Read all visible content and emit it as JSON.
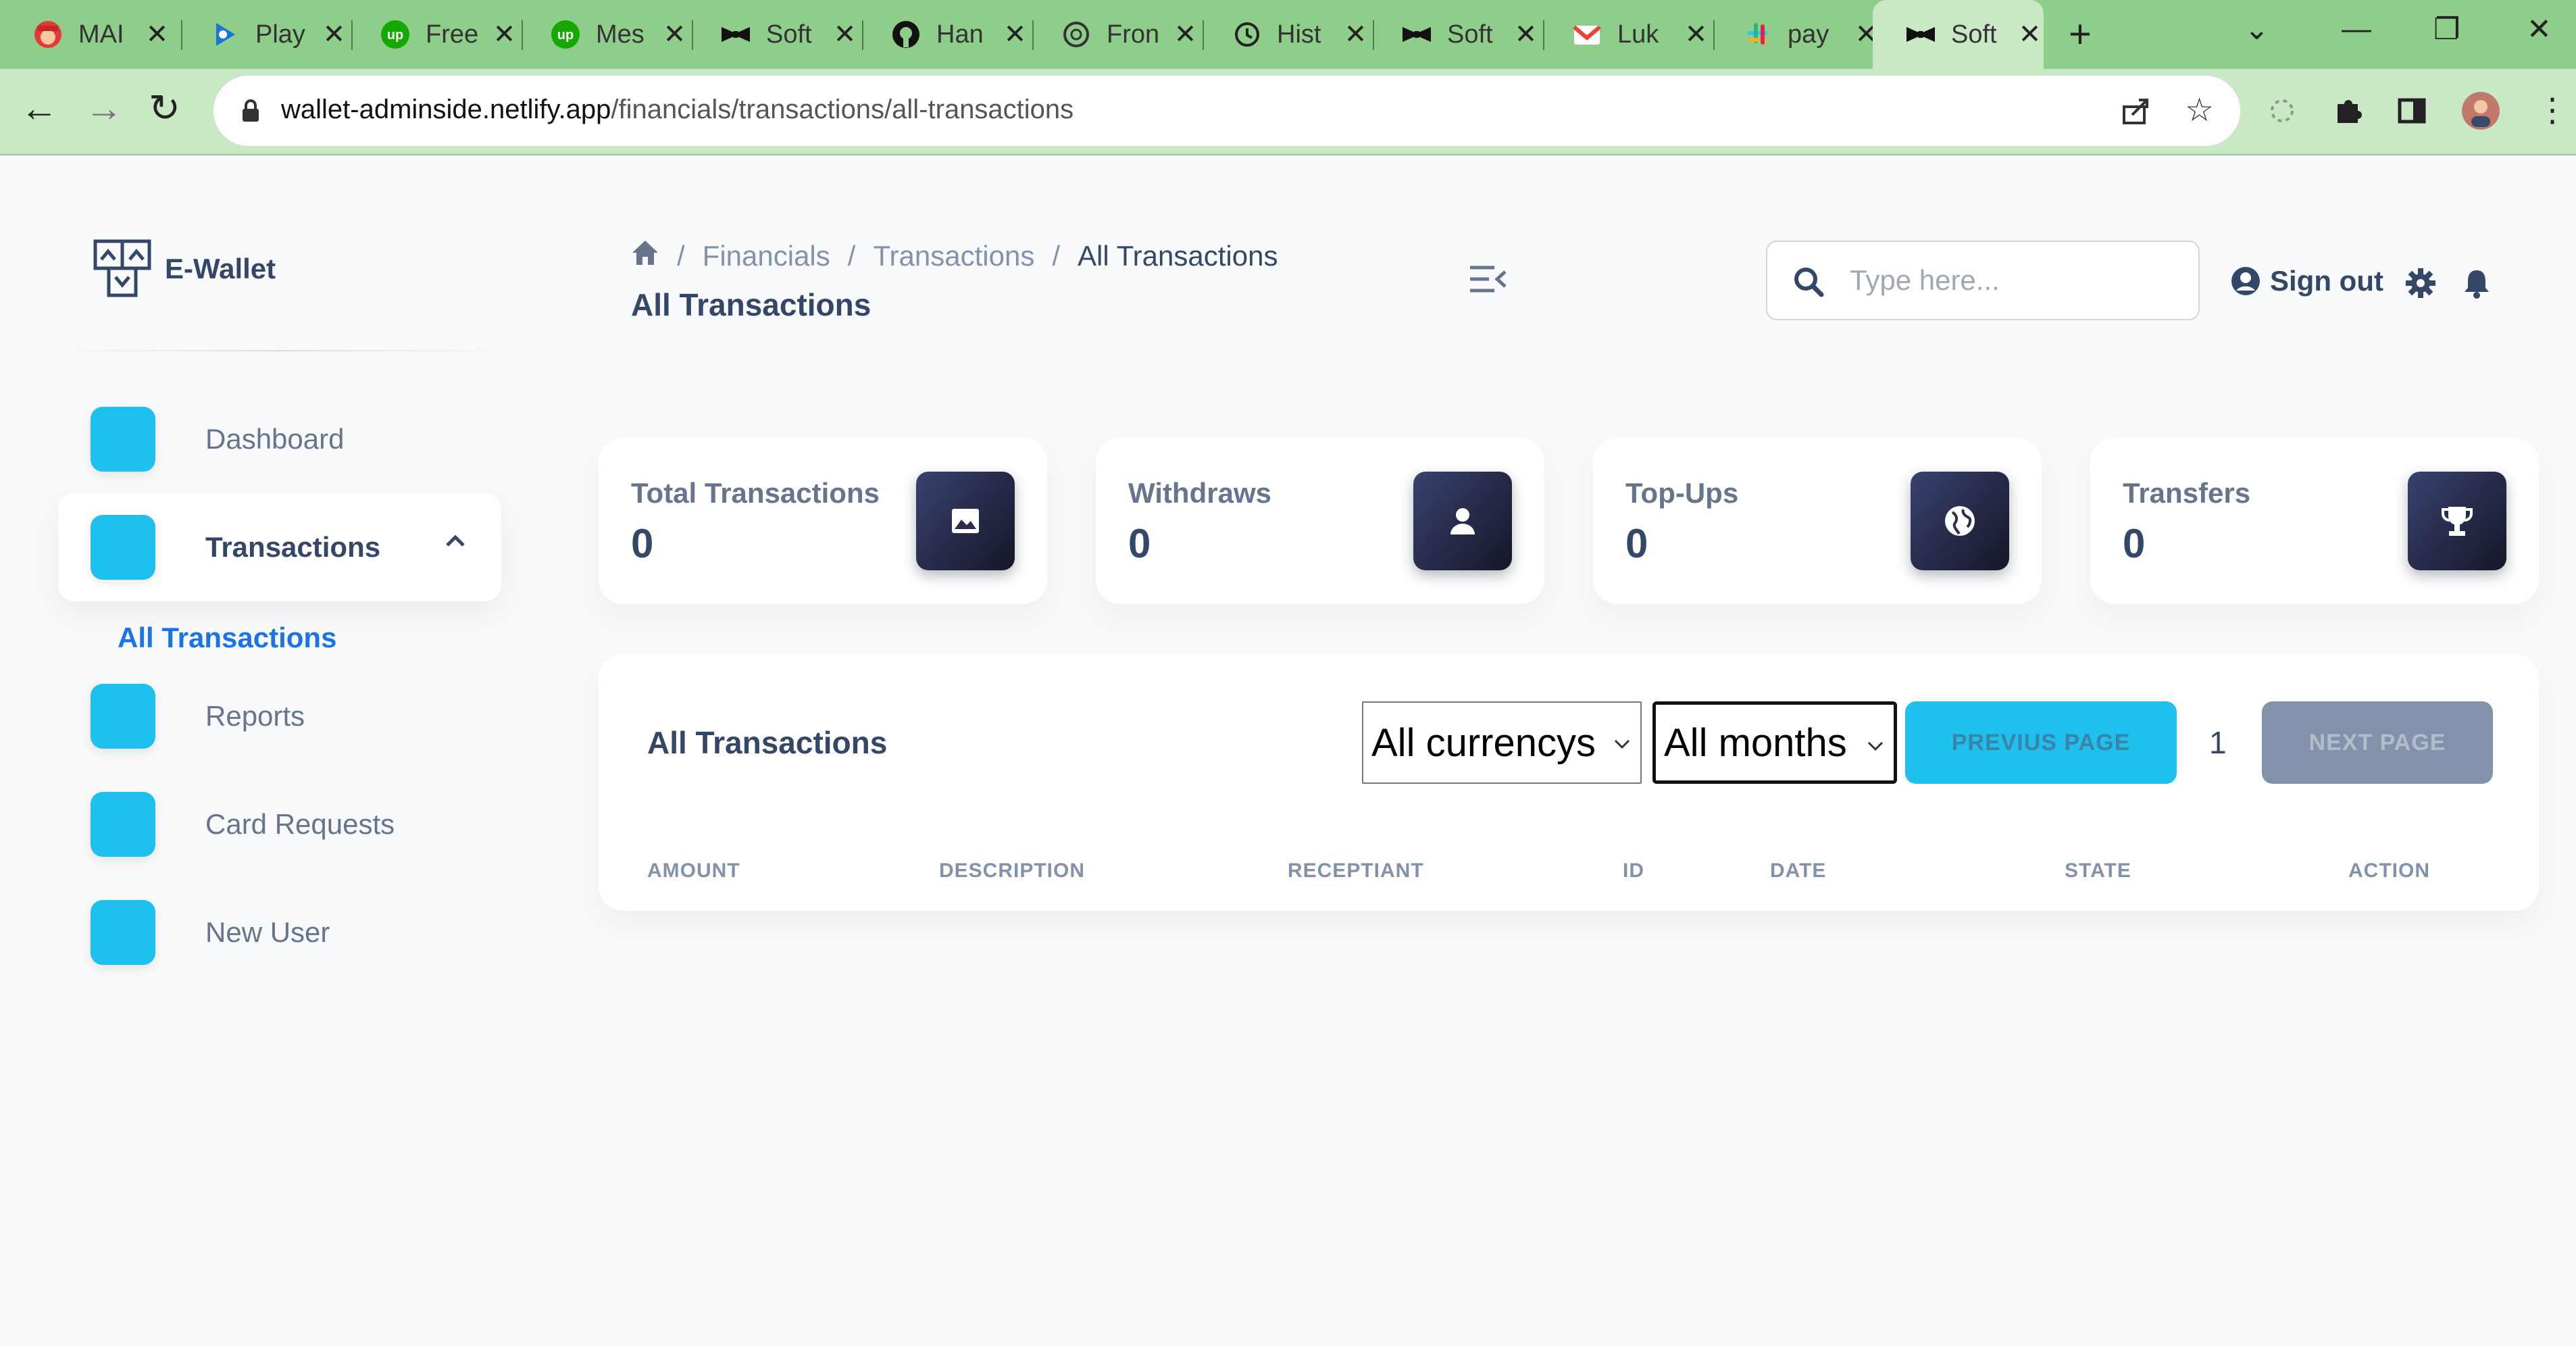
{
  "browser": {
    "tabs": [
      {
        "title": "MAI",
        "icon": "mario-icon"
      },
      {
        "title": "Play",
        "icon": "play-icon"
      },
      {
        "title": "Free",
        "icon": "upwork-icon"
      },
      {
        "title": "Mes",
        "icon": "upwork-icon"
      },
      {
        "title": "Soft",
        "icon": "bowtie-icon"
      },
      {
        "title": "Han",
        "icon": "github-icon"
      },
      {
        "title": "Fron",
        "icon": "openai-icon"
      },
      {
        "title": "Hist",
        "icon": "history-icon"
      },
      {
        "title": "Soft",
        "icon": "bowtie-icon"
      },
      {
        "title": "Luk",
        "icon": "gmail-icon"
      },
      {
        "title": "pay",
        "icon": "slack-icon"
      },
      {
        "title": "Soft",
        "icon": "bowtie-icon"
      }
    ],
    "active_tab_index": 11,
    "url_host": "wallet-adminside.netlify.app",
    "url_path": "/financials/transactions/all-transactions"
  },
  "sidebar": {
    "brand": "E-Wallet",
    "items": [
      {
        "label": "Dashboard"
      },
      {
        "label": "Transactions"
      },
      {
        "label": "Reports"
      },
      {
        "label": "Card Requests"
      },
      {
        "label": "New User"
      }
    ],
    "sub_item": "All Transactions",
    "accent_color": "#1ec0ee"
  },
  "header": {
    "breadcrumb": [
      "Financials",
      "Transactions",
      "All Transactions"
    ],
    "title": "All Transactions",
    "search_placeholder": "Type here...",
    "sign_out": "Sign out"
  },
  "cards": [
    {
      "label": "Total Transactions",
      "value": "0",
      "icon": "image-icon"
    },
    {
      "label": "Withdraws",
      "value": "0",
      "icon": "user-icon"
    },
    {
      "label": "Top-Ups",
      "value": "0",
      "icon": "globe-icon"
    },
    {
      "label": "Transfers",
      "value": "0",
      "icon": "trophy-icon"
    }
  ],
  "table": {
    "title": "All Transactions",
    "currency_filter": "All currencys",
    "month_filter": "All months",
    "prev_label": "PREVIUS PAGE",
    "next_label": "NEXT PAGE",
    "page": "1",
    "columns": [
      "AMOUNT",
      "DESCRIPTION",
      "RECEPTIANT",
      "ID",
      "DATE",
      "STATE",
      "ACTION"
    ]
  }
}
